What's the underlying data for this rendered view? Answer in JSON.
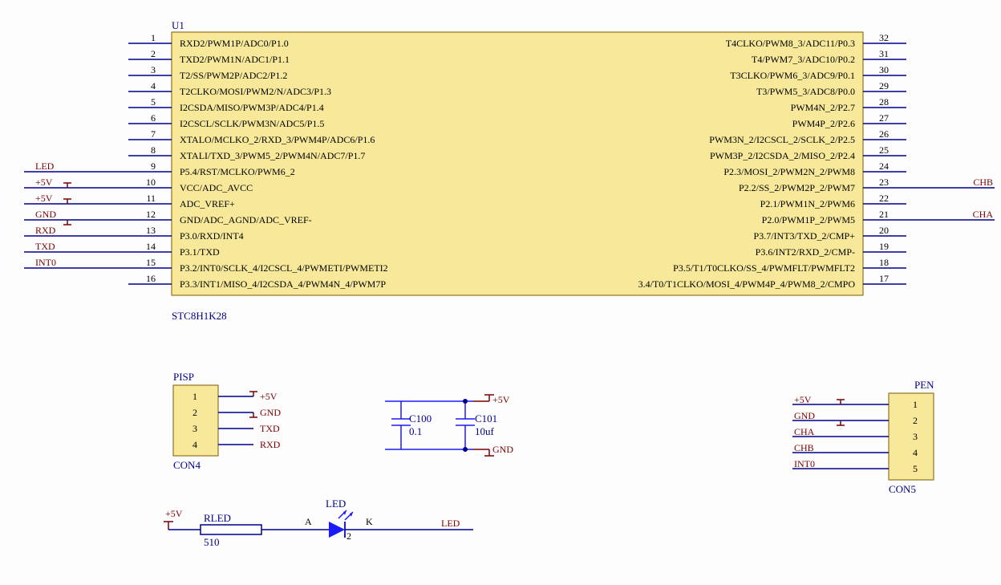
{
  "u1": {
    "ref": "U1",
    "part": "STC8H1K28",
    "left": [
      {
        "n": "1",
        "name": "RXD2/PWM1P/ADC0/P1.0",
        "net": ""
      },
      {
        "n": "2",
        "name": "TXD2/PWM1N/ADC1/P1.1",
        "net": ""
      },
      {
        "n": "3",
        "name": "T2/SS/PWM2P/ADC2/P1.2",
        "net": ""
      },
      {
        "n": "4",
        "name": "T2CLKO/MOSI/PWM2/N/ADC3/P1.3",
        "net": ""
      },
      {
        "n": "5",
        "name": "I2CSDA/MISO/PWM3P/ADC4/P1.4",
        "net": ""
      },
      {
        "n": "6",
        "name": "I2CSCL/SCLK/PWM3N/ADC5/P1.5",
        "net": ""
      },
      {
        "n": "7",
        "name": "XTALO/MCLKO_2/RXD_3/PWM4P/ADC6/P1.6",
        "net": ""
      },
      {
        "n": "8",
        "name": "XTALI/TXD_3/PWM5_2/PWM4N/ADC7/P1.7",
        "net": ""
      },
      {
        "n": "9",
        "name": "P5.4/RST/MCLKO/PWM6_2",
        "net": "LED"
      },
      {
        "n": "10",
        "name": "VCC/ADC_AVCC",
        "net": "+5V"
      },
      {
        "n": "11",
        "name": "ADC_VREF+",
        "net": "+5V"
      },
      {
        "n": "12",
        "name": "GND/ADC_AGND/ADC_VREF-",
        "net": "GND"
      },
      {
        "n": "13",
        "name": "P3.0/RXD/INT4",
        "net": "RXD"
      },
      {
        "n": "14",
        "name": "P3.1/TXD",
        "net": "TXD"
      },
      {
        "n": "15",
        "name": "P3.2/INT0/SCLK_4/I2CSCL_4/PWMETI/PWMETI2",
        "net": "INT0"
      },
      {
        "n": "16",
        "name": "P3.3/INT1/MISO_4/I2CSDA_4/PWM4N_4/PWM7P",
        "net": ""
      }
    ],
    "right": [
      {
        "n": "32",
        "name": "T4CLKO/PWM8_3/ADC11/P0.3",
        "net": ""
      },
      {
        "n": "31",
        "name": "T4/PWM7_3/ADC10/P0.2",
        "net": ""
      },
      {
        "n": "30",
        "name": "T3CLKO/PWM6_3/ADC9/P0.1",
        "net": ""
      },
      {
        "n": "29",
        "name": "T3/PWM5_3/ADC8/P0.0",
        "net": ""
      },
      {
        "n": "28",
        "name": "PWM4N_2/P2.7",
        "net": ""
      },
      {
        "n": "27",
        "name": "PWM4P_2/P2.6",
        "net": ""
      },
      {
        "n": "26",
        "name": "PWM3N_2/I2CSCL_2/SCLK_2/P2.5",
        "net": ""
      },
      {
        "n": "25",
        "name": "PWM3P_2/I2CSDA_2/MISO_2/P2.4",
        "net": ""
      },
      {
        "n": "24",
        "name": "P2.3/MOSI_2/PWM2N_2/PWM8",
        "net": ""
      },
      {
        "n": "23",
        "name": "P2.2/SS_2/PWM2P_2/PWM7",
        "net": "CHB"
      },
      {
        "n": "22",
        "name": "P2.1/PWM1N_2/PWM6",
        "net": ""
      },
      {
        "n": "21",
        "name": "P2.0/PWM1P_2/PWM5",
        "net": "CHA"
      },
      {
        "n": "20",
        "name": "P3.7/INT3/TXD_2/CMP+",
        "net": ""
      },
      {
        "n": "19",
        "name": "P3.6/INT2/RXD_2/CMP-",
        "net": ""
      },
      {
        "n": "18",
        "name": "P3.5/T1/T0CLKO/SS_4/PWMFLT/PWMFLT2",
        "net": ""
      },
      {
        "n": "17",
        "name": "3.4/T0/T1CLKO/MOSI_4/PWM4P_4/PWM8_2/CMPO",
        "net": ""
      }
    ]
  },
  "con4": {
    "ref": "PISP",
    "part": "CON4",
    "pins": [
      {
        "n": "1",
        "net": "+5V"
      },
      {
        "n": "2",
        "net": "GND"
      },
      {
        "n": "3",
        "net": "TXD"
      },
      {
        "n": "4",
        "net": "RXD"
      }
    ]
  },
  "con5": {
    "ref": "PEN",
    "part": "CON5",
    "pins": [
      {
        "n": "1",
        "net": "+5V"
      },
      {
        "n": "2",
        "net": "GND"
      },
      {
        "n": "3",
        "net": "CHA"
      },
      {
        "n": "4",
        "net": "CHB"
      },
      {
        "n": "5",
        "net": "INT0"
      }
    ]
  },
  "caps": {
    "c100": {
      "ref": "C100",
      "val": "0.1"
    },
    "c101": {
      "ref": "C101",
      "val": "10uf"
    },
    "top": "+5V",
    "bot": "GND"
  },
  "led": {
    "r_ref": "RLED",
    "r_val": "510",
    "d_ref": "LED",
    "a": "A",
    "k": "K",
    "d_pin": "2",
    "left": "+5V",
    "right": "LED"
  }
}
